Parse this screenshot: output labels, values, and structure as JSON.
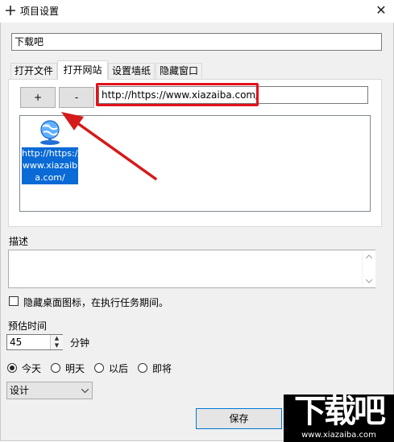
{
  "window": {
    "title": "项目设置",
    "app_icon": "plus-icon",
    "close_glyph": "✕"
  },
  "name_field": {
    "value": "下载吧"
  },
  "tabs": [
    {
      "label": "打开文件",
      "active": false
    },
    {
      "label": "打开网站",
      "active": true
    },
    {
      "label": "设置墙纸",
      "active": false
    },
    {
      "label": "隐藏窗口",
      "active": false
    }
  ],
  "website_tab": {
    "add_label": "+",
    "remove_label": "-",
    "url_value": "http://https://www.xiazaiba.com/",
    "item": {
      "icon": "globe-network-icon",
      "label_lines": [
        "http://https://",
        "www.xiazaib",
        "a.com/"
      ]
    }
  },
  "description": {
    "label": "描述",
    "value": ""
  },
  "hide_icons": {
    "label": "隐藏桌面图标，在执行任务期间。",
    "checked": false
  },
  "estimated_time": {
    "label": "预估时间",
    "value": "45",
    "unit": "分钟"
  },
  "day_options": [
    {
      "label": "今天",
      "selected": true
    },
    {
      "label": "明天",
      "selected": false
    },
    {
      "label": "以后",
      "selected": false
    },
    {
      "label": "即将",
      "selected": false
    }
  ],
  "category_select": {
    "value": "设计"
  },
  "save_label": "保存",
  "watermark": {
    "big": "下载吧",
    "small": "www.xiazaiba.com"
  },
  "colors": {
    "highlight_box": "#e3111a",
    "selection": "#0a6ad6",
    "arrow": "#d41a1a"
  }
}
